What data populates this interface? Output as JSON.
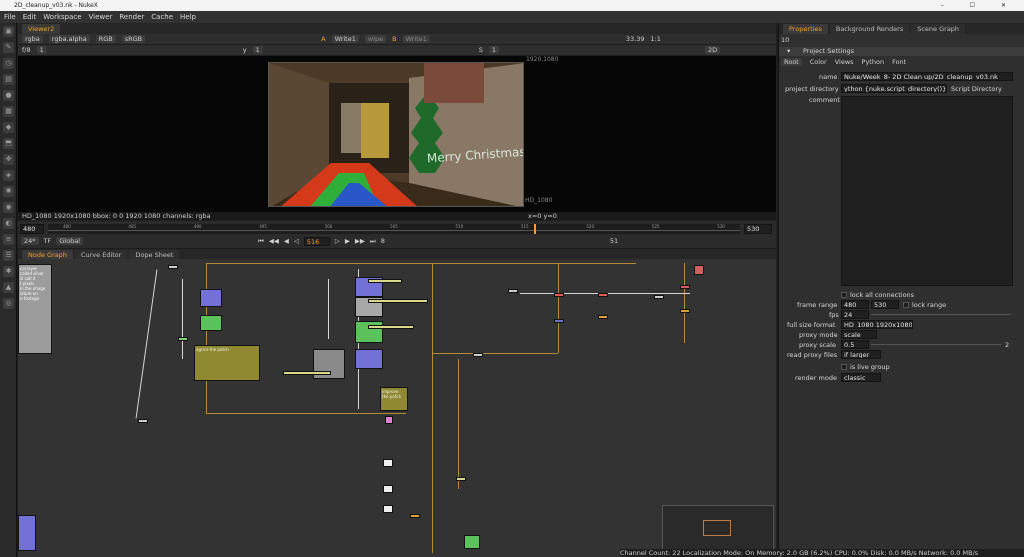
{
  "window": {
    "title": "2D_cleanup_v03.nk - NukeX",
    "controls": "– ☐ ✕"
  },
  "menu": [
    "File",
    "Edit",
    "Workspace",
    "Viewer",
    "Render",
    "Cache",
    "Help"
  ],
  "viewer": {
    "tab": "Viewer2",
    "row1": {
      "channels": "rgba",
      "alpha": "rgba.alpha",
      "colorspace": "RGB",
      "lut": "sRGB",
      "a_label": "A",
      "a_input": "Write1",
      "mode": "wipe",
      "b_label": "B",
      "b_input": "Write1",
      "zoom": "33.39",
      "ratio": "1:1"
    },
    "row2": {
      "fstop": "f/8",
      "fstop_val": "1",
      "y_label": "y",
      "y_val": "1",
      "s_label": "S",
      "s_val": "1",
      "view_mode": "2D"
    },
    "format_top_right": "1920,1080",
    "format_bottom": "HD_1080",
    "info": "HD_1080 1920x1080  bbox: 0 0 1920 1080 channels: rgba",
    "coords": "x=0 y=0",
    "image_text": "Merry Christmas"
  },
  "timeline": {
    "start": "480",
    "end": "530",
    "ticks": [
      "480",
      "485",
      "490",
      "495",
      "500",
      "505",
      "510",
      "515",
      "520",
      "525",
      "530"
    ],
    "fps": "24*",
    "tf": "TF",
    "scope": "Global",
    "current": "516",
    "step": "8",
    "end_frame": "51"
  },
  "nodegraph": {
    "tabs": [
      "Node Graph",
      "Curve Editor",
      "Dope Sheet"
    ],
    "sticky": [
      "cal layer",
      "called silver",
      "ill call it",
      "",
      "t pixels",
      "in the image",
      "ixture on",
      "n footage"
    ],
    "labels": [
      "agrice the patch",
      "improve the patch"
    ]
  },
  "properties": {
    "tabs": [
      "Properties",
      "Background Renders",
      "Scene Graph"
    ],
    "count": "10",
    "header": "Project Settings",
    "subtabs": [
      "Root",
      "Color",
      "Views",
      "Python",
      "Font"
    ],
    "name_label": "name",
    "name_value": "Nuke/Week_8- 2D Clean up/2D_cleanup_v03.nk",
    "dir_label": "project directory",
    "dir_value": "ython {nuke.script_directory()}]",
    "dir_button": "Script Directory",
    "comment_label": "comment",
    "lock_all": "lock all connections",
    "frame_range_label": "frame range",
    "frame_start": "480",
    "frame_end": "530",
    "lock_range": "lock range",
    "fps_label": "fps",
    "fps_value": "24",
    "full_size_label": "full size format",
    "full_size_value": "HD_1080 1920x1080",
    "proxy_mode_label": "proxy mode",
    "proxy_mode_value": "scale",
    "proxy_scale_label": "proxy scale",
    "proxy_scale_value": "0.5",
    "proxy_scale_max": "2",
    "read_proxy_label": "read proxy files",
    "read_proxy_value": "if larger",
    "live_group": "is live group",
    "render_mode_label": "render mode",
    "render_mode_value": "classic"
  },
  "status": "Channel Count: 22 Localization Mode: On Memory: 2.0 GB (6.2%) CPU: 0.0% Disk: 0.0 MB/s Network: 0.0 MB/s"
}
